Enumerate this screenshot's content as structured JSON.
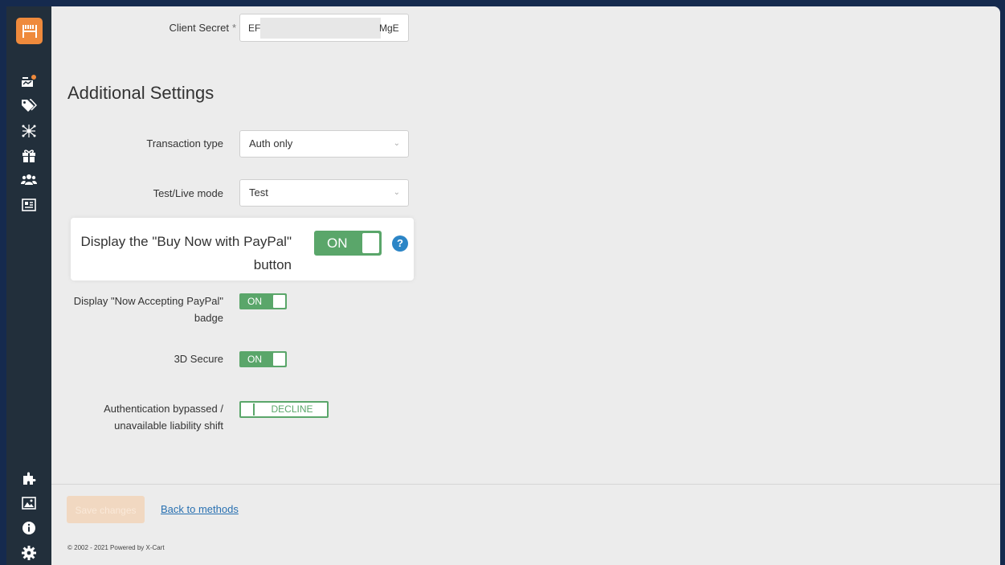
{
  "sidebar": {
    "logo_icon": "xcart-logo-icon",
    "top_icons": [
      "store-dashboard-icon",
      "tags-icon",
      "network-icon",
      "gift-icon",
      "users-icon",
      "content-icon"
    ],
    "bottom_icons": [
      "puzzle-icon",
      "image-icon",
      "info-icon",
      "gear-icon"
    ],
    "logo_color": "#ef8a3c"
  },
  "form": {
    "client_secret": {
      "label": "Client Secret",
      "required_mark": "*",
      "value_start": "EF",
      "value_end": "MgE"
    },
    "section_title": "Additional Settings",
    "transaction_type": {
      "label": "Transaction type",
      "value": "Auth only"
    },
    "test_live_mode": {
      "label": "Test/Live mode",
      "value": "Test"
    },
    "buy_now": {
      "label": "Display the \"Buy Now with PayPal\" button",
      "state": "ON",
      "help": "?"
    },
    "accepting_badge": {
      "label": "Display \"Now Accepting PayPal\" badge",
      "state": "ON"
    },
    "secure_3d": {
      "label": "3D Secure",
      "state": "ON"
    },
    "auth_bypass": {
      "label": "Authentication bypassed / unavailable liability shift",
      "state": "DECLINE"
    }
  },
  "footer": {
    "save_label": "Save changes",
    "back_label": "Back to methods",
    "copyright": "© 2002 - 2021 Powered by X-Cart"
  },
  "colors": {
    "toggle_on": "#5aa66a",
    "help": "#2c85c6",
    "link": "#2870b1"
  }
}
